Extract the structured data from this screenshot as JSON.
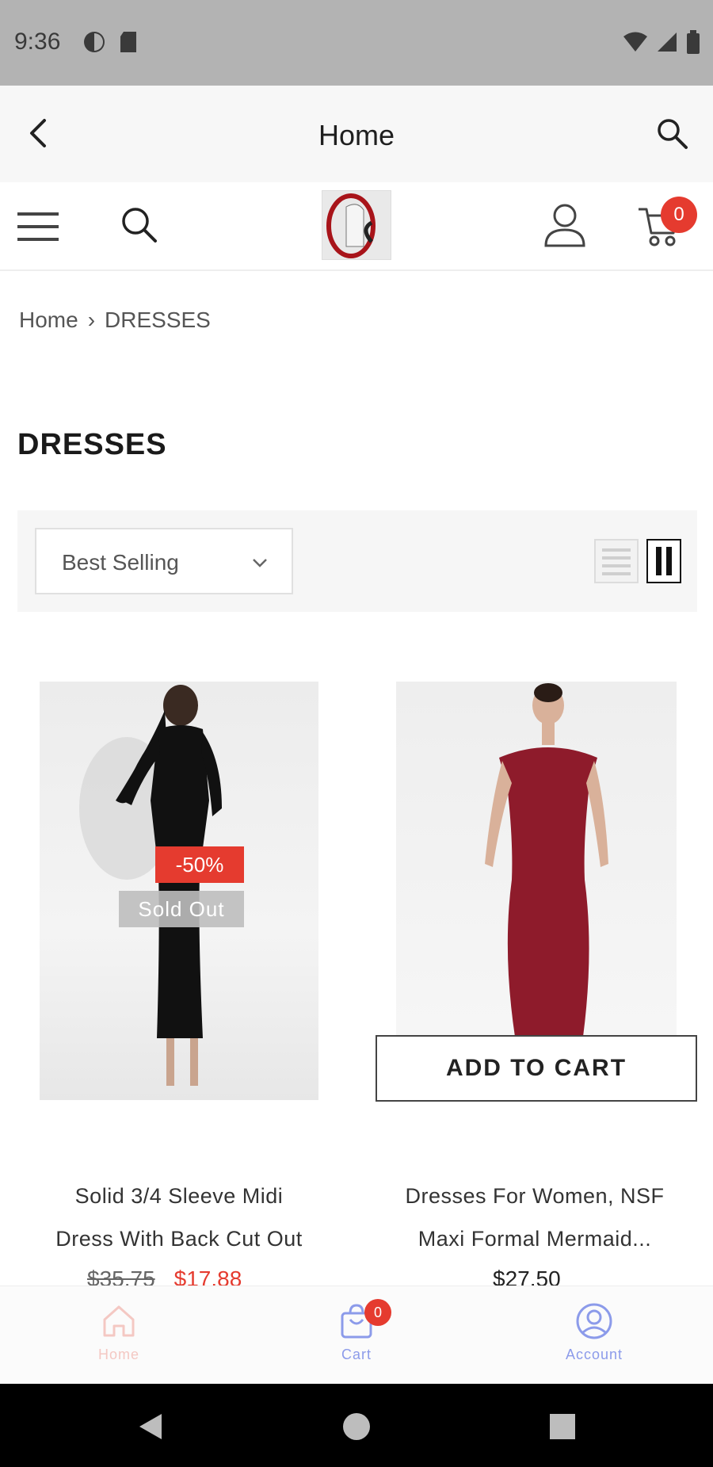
{
  "status_bar": {
    "time": "9:36"
  },
  "app_bar": {
    "title": "Home"
  },
  "header": {
    "cart_count": "0"
  },
  "breadcrumb": {
    "home": "Home",
    "separator": "›",
    "current": "DRESSES"
  },
  "page": {
    "title": "DRESSES"
  },
  "toolbar": {
    "sort_value": "Best Selling"
  },
  "products": [
    {
      "title_line1": "Solid 3/4 Sleeve Midi",
      "title_line2": "Dress With Back Cut Out",
      "old_price": "$35.75",
      "sale_price": "$17.88",
      "badge_sale": "-50%",
      "badge_status": "Sold Out"
    },
    {
      "title_line1": "Dresses For Women, NSF",
      "title_line2": "Maxi Formal Mermaid...",
      "price": "$27.50",
      "button": "ADD TO CART"
    }
  ],
  "bottom_nav": {
    "home": "Home",
    "cart": "Cart",
    "cart_badge": "0",
    "account": "Account"
  },
  "colors": {
    "accent_red": "#e53b2f",
    "nav_blue": "#8c9bea",
    "nav_home_faded": "#f4c8c3",
    "dress_red": "#8e1b2b"
  }
}
